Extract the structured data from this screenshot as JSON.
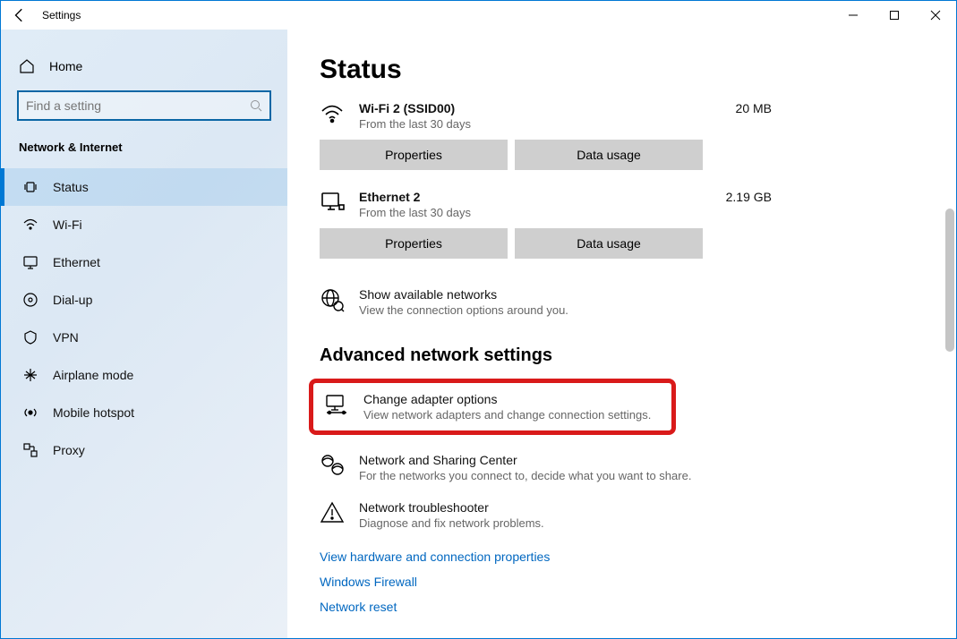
{
  "window": {
    "title": "Settings"
  },
  "sidebar": {
    "home": "Home",
    "search_placeholder": "Find a setting",
    "category": "Network & Internet",
    "items": [
      {
        "icon": "status-icon",
        "label": "Status",
        "active": true
      },
      {
        "icon": "wifi-icon",
        "label": "Wi-Fi"
      },
      {
        "icon": "ethernet-icon",
        "label": "Ethernet"
      },
      {
        "icon": "dialup-icon",
        "label": "Dial-up"
      },
      {
        "icon": "vpn-icon",
        "label": "VPN"
      },
      {
        "icon": "airplane-icon",
        "label": "Airplane mode"
      },
      {
        "icon": "hotspot-icon",
        "label": "Mobile hotspot"
      },
      {
        "icon": "proxy-icon",
        "label": "Proxy"
      }
    ]
  },
  "main": {
    "title": "Status",
    "connections": [
      {
        "name": "Wi-Fi 2 (SSID00)",
        "sub": "From the last 30 days",
        "usage": "20 MB",
        "icon": "wifi-icon"
      },
      {
        "name": "Ethernet 2",
        "sub": "From the last 30 days",
        "usage": "2.19 GB",
        "icon": "ethernet-icon"
      }
    ],
    "buttons": {
      "properties": "Properties",
      "data_usage": "Data usage"
    },
    "show_networks": {
      "title": "Show available networks",
      "sub": "View the connection options around you."
    },
    "advanced_title": "Advanced network settings",
    "advanced": [
      {
        "title": "Change adapter options",
        "sub": "View network adapters and change connection settings.",
        "highlight": true,
        "icon": "adapter-icon"
      },
      {
        "title": "Network and Sharing Center",
        "sub": "For the networks you connect to, decide what you want to share.",
        "icon": "sharing-icon"
      },
      {
        "title": "Network troubleshooter",
        "sub": "Diagnose and fix network problems.",
        "icon": "warn-icon"
      }
    ],
    "links": [
      "View hardware and connection properties",
      "Windows Firewall",
      "Network reset"
    ]
  }
}
